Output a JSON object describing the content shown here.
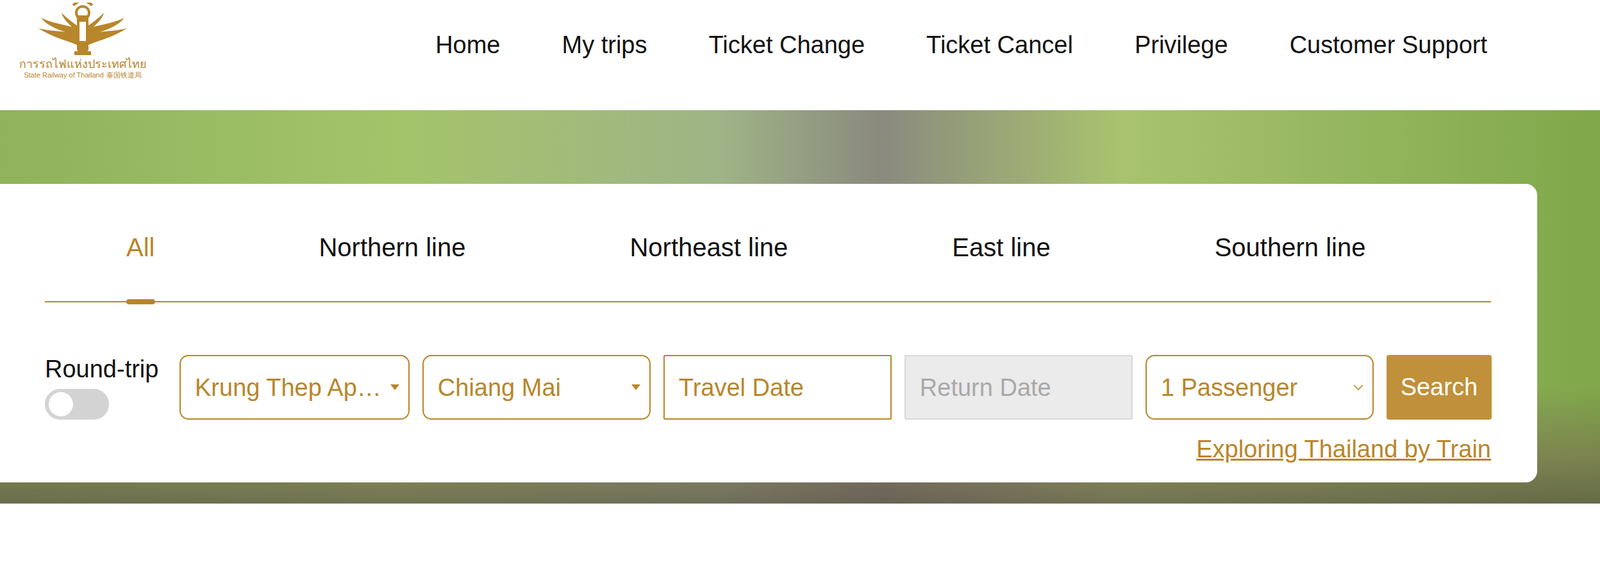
{
  "logo": {
    "thai": "การรถไฟแห่งประเทศไทย",
    "english": "State Railway of Thailand",
    "chinese": "泰国铁道局"
  },
  "nav": [
    {
      "label": "Home"
    },
    {
      "label": "My trips"
    },
    {
      "label": "Ticket Change"
    },
    {
      "label": "Ticket Cancel"
    },
    {
      "label": "Privilege"
    },
    {
      "label": "Customer Support"
    }
  ],
  "tabs": [
    {
      "label": "All",
      "selected": true
    },
    {
      "label": "Northern line",
      "selected": false
    },
    {
      "label": "Northeast line",
      "selected": false
    },
    {
      "label": "East line",
      "selected": false
    },
    {
      "label": "Southern line",
      "selected": false
    }
  ],
  "round_trip": {
    "label": "Round-trip",
    "on": false
  },
  "origin": {
    "value": "Krung Thep Ap…"
  },
  "destination": {
    "value": "Chiang Mai"
  },
  "travel_date": {
    "placeholder": "Travel Date",
    "disabled": false
  },
  "return_date": {
    "placeholder": "Return Date",
    "disabled": true
  },
  "passengers": {
    "value": "1 Passenger"
  },
  "search_button": {
    "label": "Search"
  },
  "explore_link": {
    "label": "Exploring Thailand by Train"
  }
}
